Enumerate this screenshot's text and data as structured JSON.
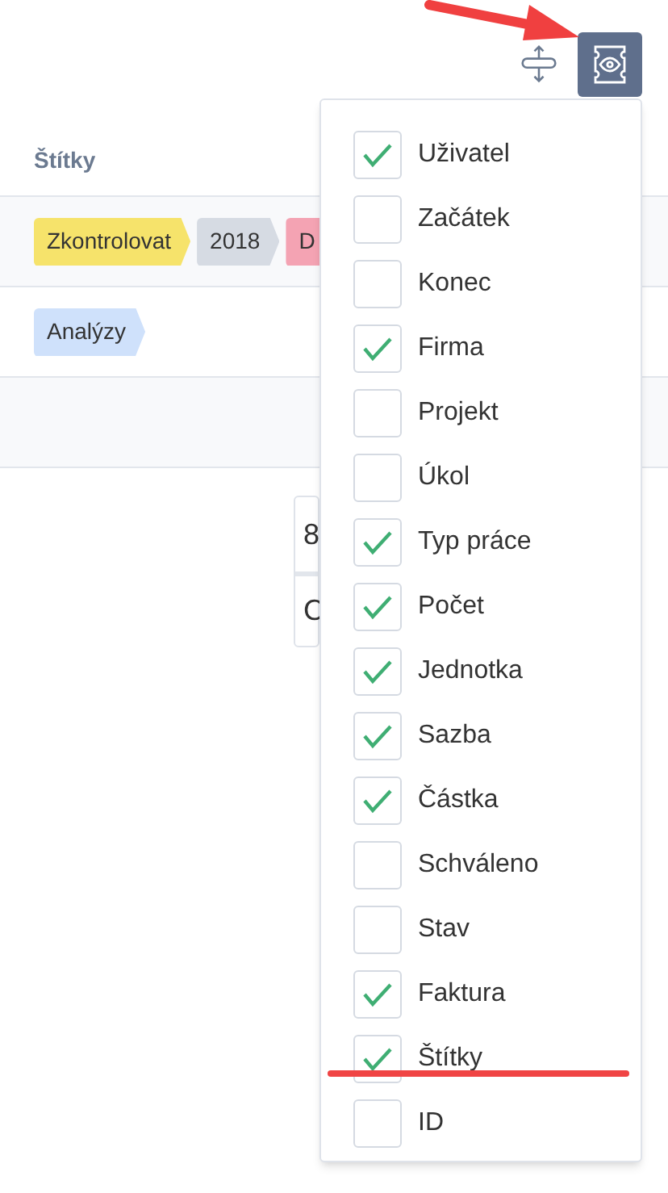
{
  "table": {
    "header": "Štítky",
    "rows": [
      {
        "tags": [
          {
            "label": "Zkontrolovat",
            "color": "#f6e36b"
          },
          {
            "label": "2018",
            "color": "#d6dbe3"
          },
          {
            "label": "D",
            "color": "#f4a3b3"
          }
        ]
      },
      {
        "tags": [
          {
            "label": "Analýzy",
            "color": "#cfe1fb"
          }
        ]
      },
      {
        "tags": []
      }
    ]
  },
  "partial_cells": [
    "8",
    "C"
  ],
  "column_menu": {
    "items": [
      {
        "label": "Uživatel",
        "checked": true
      },
      {
        "label": "Začátek",
        "checked": false
      },
      {
        "label": "Konec",
        "checked": false
      },
      {
        "label": "Firma",
        "checked": true
      },
      {
        "label": "Projekt",
        "checked": false
      },
      {
        "label": "Úkol",
        "checked": false
      },
      {
        "label": "Typ práce",
        "checked": true
      },
      {
        "label": "Počet",
        "checked": true
      },
      {
        "label": "Jednotka",
        "checked": true
      },
      {
        "label": "Sazba",
        "checked": true
      },
      {
        "label": "Částka",
        "checked": true
      },
      {
        "label": "Schváleno",
        "checked": false
      },
      {
        "label": "Stav",
        "checked": false
      },
      {
        "label": "Faktura",
        "checked": true
      },
      {
        "label": "Štítky",
        "checked": true
      },
      {
        "label": "ID",
        "checked": false
      }
    ]
  }
}
